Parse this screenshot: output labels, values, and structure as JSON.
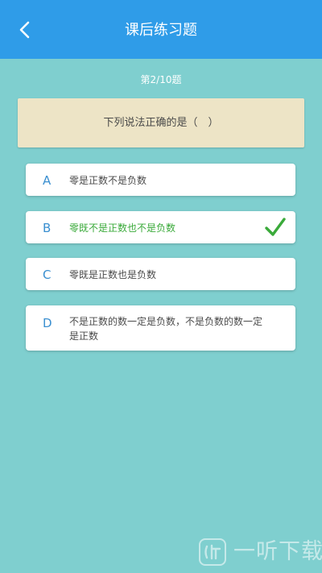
{
  "header": {
    "title": "课后练习题",
    "back_icon": "chevron-left-icon"
  },
  "progress": {
    "text": "第2/10题",
    "current": 2,
    "total": 10
  },
  "question": {
    "text": "下列说法正确的是（　）"
  },
  "options": [
    {
      "letter": "A",
      "text": "零是正数不是负数",
      "selected": false
    },
    {
      "letter": "B",
      "text": "零既不是正数也不是负数",
      "selected": true,
      "correct": true
    },
    {
      "letter": "C",
      "text": "零既是正数也是负数",
      "selected": false
    },
    {
      "letter": "D",
      "text": "不是正数的数一定是负数，不是负数的数一定是正数",
      "selected": false
    }
  ],
  "watermark": {
    "text": "一听下载",
    "logo_icon": "ear-logo-icon"
  },
  "colors": {
    "header_bg": "#2f9ce8",
    "page_bg": "#7fcfcf",
    "question_bg": "#ede4c6",
    "option_letter": "#3a8fd0",
    "correct_green": "#3aaa3a"
  }
}
